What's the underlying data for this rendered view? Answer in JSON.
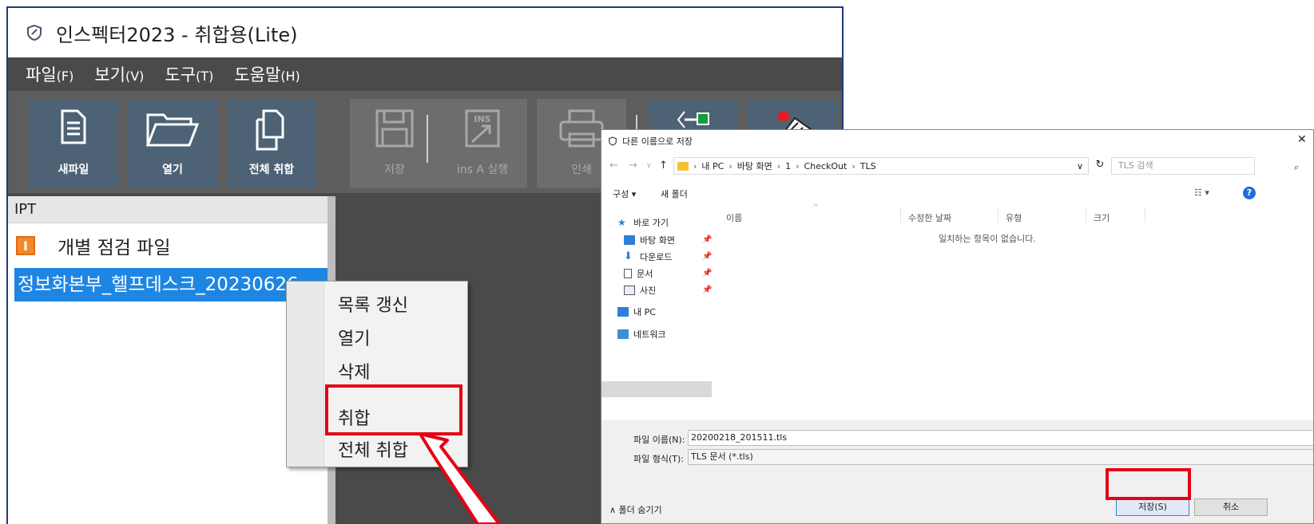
{
  "app": {
    "title": "인스펙터2023 - 취합용(Lite)",
    "menu": [
      {
        "label": "파일",
        "key": "(F)"
      },
      {
        "label": "보기",
        "key": "(V)"
      },
      {
        "label": "도구",
        "key": "(T)"
      },
      {
        "label": "도움말",
        "key": "(H)"
      }
    ],
    "toolbar": [
      {
        "label": "새파일",
        "icon": "new-file-icon",
        "enabled": true
      },
      {
        "label": "열기",
        "icon": "open-folder-icon",
        "enabled": true
      },
      {
        "label": "전체 취합",
        "icon": "merge-all-icon",
        "enabled": true
      },
      {
        "label": "저장",
        "icon": "save-disk-icon",
        "enabled": false
      },
      {
        "label": "ins A 실행",
        "icon": "ins-run-icon",
        "enabled": false
      },
      {
        "label": "인쇄",
        "icon": "printer-icon",
        "enabled": false
      },
      {
        "label": "",
        "icon": "network-icon",
        "enabled": true
      },
      {
        "label": "",
        "icon": "server-icon",
        "enabled": true
      }
    ],
    "panel": {
      "header": "IPT",
      "group_badge": "I",
      "group_label": "개별 점검 파일",
      "selected_file": "정보화본부_헬프데스크_20230626"
    },
    "context_menu": {
      "items": [
        "목록 갱신",
        "열기",
        "삭제",
        "취합",
        "전체 취합"
      ],
      "highlighted": "취합"
    }
  },
  "dialog": {
    "title": "다른 이름으로 저장",
    "close": "✕",
    "address": {
      "crumbs": [
        "내 PC",
        "바탕 화면",
        "1",
        "CheckOut",
        "TLS"
      ],
      "search_placeholder": "TLS 검색"
    },
    "commands": {
      "organize": "구성 ▾",
      "new_folder": "새 폴더"
    },
    "nav": [
      {
        "label": "바로 가기",
        "icon": "star-icon",
        "pinned": false
      },
      {
        "label": "바탕 화면",
        "icon": "desktop-icon",
        "pinned": true
      },
      {
        "label": "다운로드",
        "icon": "download-icon",
        "pinned": true
      },
      {
        "label": "문서",
        "icon": "document-icon",
        "pinned": true
      },
      {
        "label": "사진",
        "icon": "picture-icon",
        "pinned": true
      },
      {
        "label": "내 PC",
        "icon": "pc-icon",
        "pinned": false
      },
      {
        "label": "네트워크",
        "icon": "network-icon",
        "pinned": false
      }
    ],
    "columns": [
      "이름",
      "수정한 날짜",
      "유형",
      "크기"
    ],
    "empty_message": "일치하는 항목이 없습니다.",
    "filename_label": "파일 이름(N):",
    "filename_value": "20200218_201511.tls",
    "filetype_label": "파일 형식(T):",
    "filetype_value": "TLS 문서 (*.tls)",
    "hide_folders": "∧ 폴더 숨기기",
    "save_button": "저장(S)",
    "cancel_button": "취소"
  },
  "annotation_color": "#e60012"
}
